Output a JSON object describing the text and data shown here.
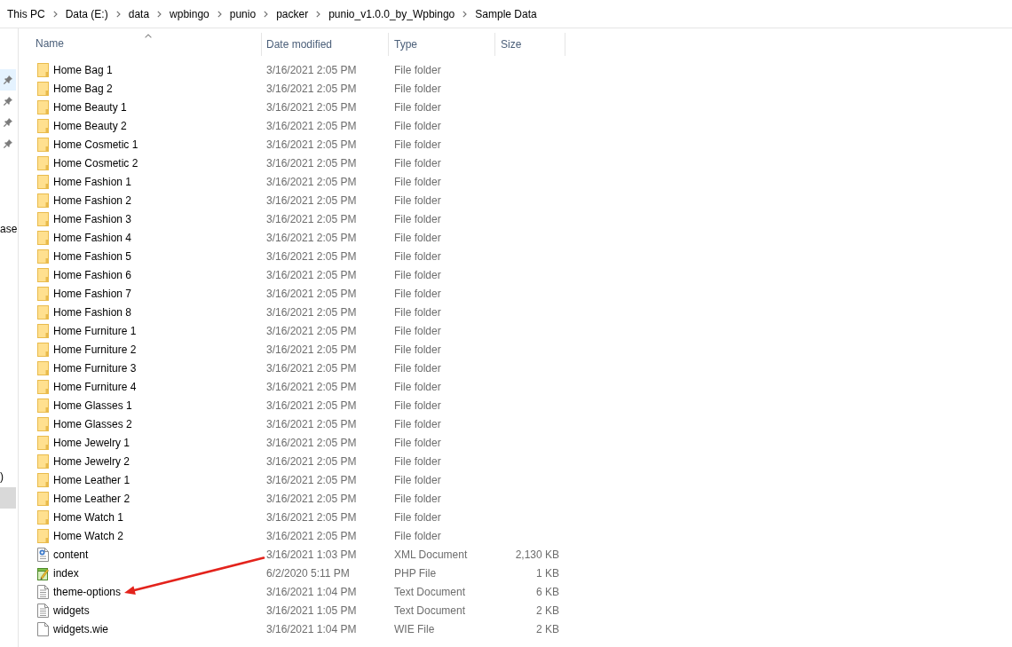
{
  "address_bar": {
    "crumbs": [
      "This PC",
      "Data (E:)",
      "data",
      "wpbingo",
      "punio",
      "packer",
      "punio_v1.0.0_by_Wpbingo",
      "Sample Data"
    ]
  },
  "navigation_pane": {
    "items": [
      {
        "kind": "pinned",
        "hovered": true,
        "selected": false
      },
      {
        "kind": "pinned",
        "hovered": false,
        "selected": false
      },
      {
        "kind": "pinned",
        "hovered": false,
        "selected": false
      },
      {
        "kind": "pinned",
        "hovered": false,
        "selected": false
      },
      {
        "kind": "label",
        "text": "ase",
        "hovered": false,
        "selected": false
      },
      {
        "kind": "label",
        "text": ")",
        "hovered": false,
        "selected": false
      },
      {
        "kind": "entry",
        "hovered": false,
        "selected": true
      }
    ]
  },
  "file_list": {
    "columns": [
      {
        "label": "Name",
        "sorted": true
      },
      {
        "label": "Date modified",
        "sorted": false
      },
      {
        "label": "Type",
        "sorted": false
      },
      {
        "label": "Size",
        "sorted": false
      }
    ],
    "rows": [
      {
        "kind": "folder",
        "name": "Home Bag 1",
        "date_modified": "3/16/2021 2:05 PM",
        "type": "File folder"
      },
      {
        "kind": "folder",
        "name": "Home Bag 2",
        "date_modified": "3/16/2021 2:05 PM",
        "type": "File folder"
      },
      {
        "kind": "folder",
        "name": "Home Beauty 1",
        "date_modified": "3/16/2021 2:05 PM",
        "type": "File folder"
      },
      {
        "kind": "folder",
        "name": "Home Beauty 2",
        "date_modified": "3/16/2021 2:05 PM",
        "type": "File folder"
      },
      {
        "kind": "folder",
        "name": "Home Cosmetic 1",
        "date_modified": "3/16/2021 2:05 PM",
        "type": "File folder"
      },
      {
        "kind": "folder",
        "name": "Home Cosmetic 2",
        "date_modified": "3/16/2021 2:05 PM",
        "type": "File folder"
      },
      {
        "kind": "folder",
        "name": "Home Fashion 1",
        "date_modified": "3/16/2021 2:05 PM",
        "type": "File folder"
      },
      {
        "kind": "folder",
        "name": "Home Fashion 2",
        "date_modified": "3/16/2021 2:05 PM",
        "type": "File folder"
      },
      {
        "kind": "folder",
        "name": "Home Fashion 3",
        "date_modified": "3/16/2021 2:05 PM",
        "type": "File folder"
      },
      {
        "kind": "folder",
        "name": "Home Fashion 4",
        "date_modified": "3/16/2021 2:05 PM",
        "type": "File folder"
      },
      {
        "kind": "folder",
        "name": "Home Fashion 5",
        "date_modified": "3/16/2021 2:05 PM",
        "type": "File folder"
      },
      {
        "kind": "folder",
        "name": "Home Fashion 6",
        "date_modified": "3/16/2021 2:05 PM",
        "type": "File folder"
      },
      {
        "kind": "folder",
        "name": "Home Fashion 7",
        "date_modified": "3/16/2021 2:05 PM",
        "type": "File folder"
      },
      {
        "kind": "folder",
        "name": "Home Fashion 8",
        "date_modified": "3/16/2021 2:05 PM",
        "type": "File folder"
      },
      {
        "kind": "folder",
        "name": "Home Furniture 1",
        "date_modified": "3/16/2021 2:05 PM",
        "type": "File folder"
      },
      {
        "kind": "folder",
        "name": "Home Furniture 2",
        "date_modified": "3/16/2021 2:05 PM",
        "type": "File folder"
      },
      {
        "kind": "folder",
        "name": "Home Furniture 3",
        "date_modified": "3/16/2021 2:05 PM",
        "type": "File folder"
      },
      {
        "kind": "folder",
        "name": "Home Furniture 4",
        "date_modified": "3/16/2021 2:05 PM",
        "type": "File folder"
      },
      {
        "kind": "folder",
        "name": "Home Glasses 1",
        "date_modified": "3/16/2021 2:05 PM",
        "type": "File folder"
      },
      {
        "kind": "folder",
        "name": "Home Glasses 2",
        "date_modified": "3/16/2021 2:05 PM",
        "type": "File folder"
      },
      {
        "kind": "folder",
        "name": "Home Jewelry 1",
        "date_modified": "3/16/2021 2:05 PM",
        "type": "File folder"
      },
      {
        "kind": "folder",
        "name": "Home Jewelry 2",
        "date_modified": "3/16/2021 2:05 PM",
        "type": "File folder"
      },
      {
        "kind": "folder",
        "name": "Home Leather 1",
        "date_modified": "3/16/2021 2:05 PM",
        "type": "File folder"
      },
      {
        "kind": "folder",
        "name": "Home Leather 2",
        "date_modified": "3/16/2021 2:05 PM",
        "type": "File folder"
      },
      {
        "kind": "folder",
        "name": "Home Watch 1",
        "date_modified": "3/16/2021 2:05 PM",
        "type": "File folder"
      },
      {
        "kind": "folder",
        "name": "Home Watch 2",
        "date_modified": "3/16/2021 2:05 PM",
        "type": "File folder"
      },
      {
        "kind": "xml",
        "name": "content",
        "date_modified": "3/16/2021 1:03 PM",
        "type": "XML Document",
        "size": "2,130 KB"
      },
      {
        "kind": "php",
        "name": "index",
        "date_modified": "6/2/2020 5:11 PM",
        "type": "PHP File",
        "size": "1 KB"
      },
      {
        "kind": "text",
        "name": "theme-options",
        "date_modified": "3/16/2021 1:04 PM",
        "type": "Text Document",
        "size": "6 KB"
      },
      {
        "kind": "text",
        "name": "widgets",
        "date_modified": "3/16/2021 1:05 PM",
        "type": "Text Document",
        "size": "2 KB"
      },
      {
        "kind": "file",
        "name": "widgets.wie",
        "date_modified": "3/16/2021 1:04 PM",
        "type": "WIE File",
        "size": "2 KB"
      }
    ]
  }
}
